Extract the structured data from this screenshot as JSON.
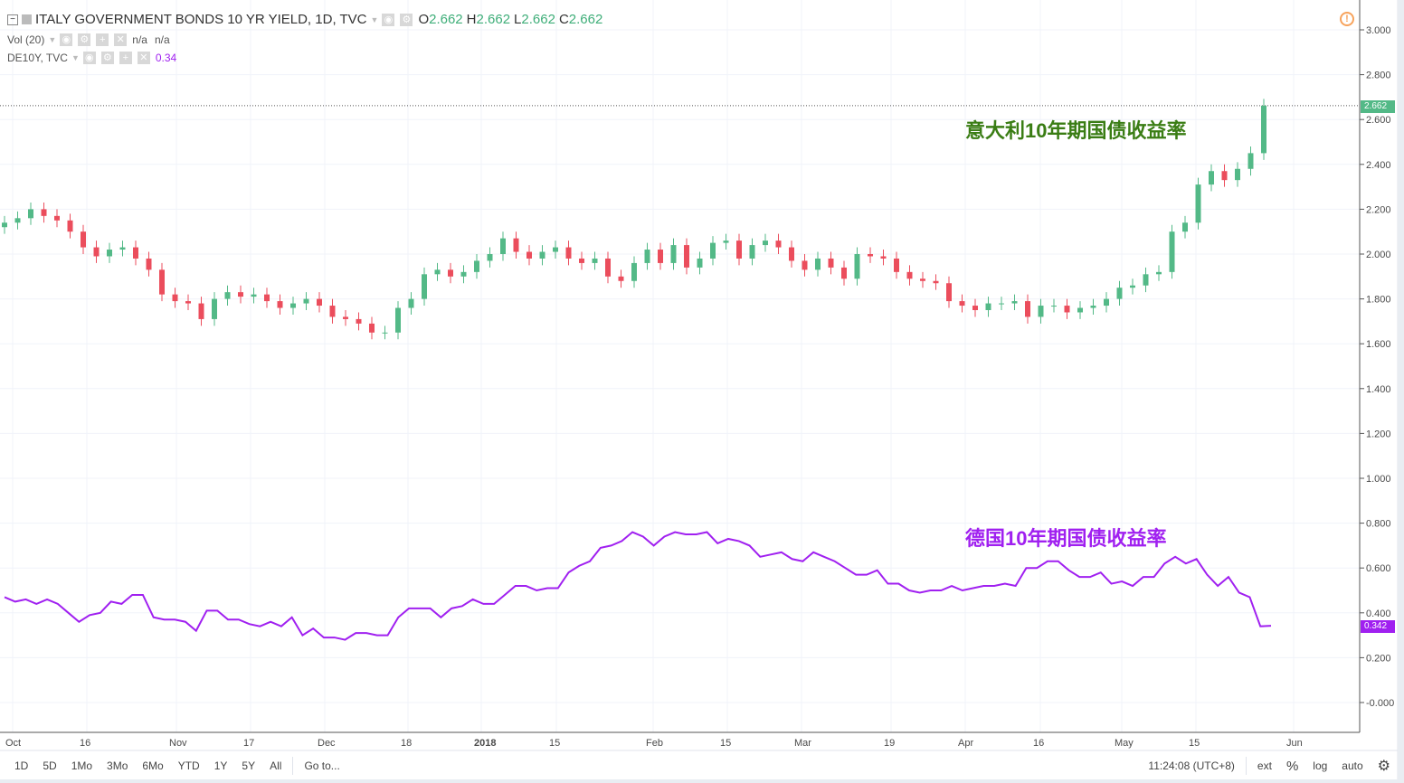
{
  "legend": {
    "symbol": "ITALY GOVERNMENT BONDS 10 YR YIELD, 1D, TVC",
    "o_label": "O",
    "o": "2.662",
    "h_label": "H",
    "h": "2.662",
    "l_label": "L",
    "l": "2.662",
    "c_label": "C",
    "c": "2.662",
    "vol": "Vol (20)",
    "vol_v1": "n/a",
    "vol_v2": "n/a",
    "de": "DE10Y, TVC",
    "de_v": "0.34"
  },
  "annotations": {
    "italy": "意大利10年期国债收益率",
    "germany": "德国10年期国债收益率"
  },
  "price_tags": {
    "italy": "2.662",
    "germany": "0.342"
  },
  "colors": {
    "up": "#53b987",
    "down": "#eb4d5c",
    "germany": "#a020f0",
    "italy_text": "#3a7d14"
  },
  "chart_data": {
    "type": "candlestick+line",
    "y_ticks": [
      "3.000",
      "2.800",
      "2.600",
      "2.400",
      "2.200",
      "2.000",
      "1.800",
      "1.600",
      "1.400",
      "1.200",
      "1.000",
      "0.800",
      "0.600",
      "0.400",
      "0.200",
      "-0.000"
    ],
    "ylim": [
      0,
      3
    ],
    "x_ticks": [
      "Oct",
      "16",
      "Nov",
      "17",
      "Dec",
      "18",
      "2018",
      "15",
      "Feb",
      "15",
      "Mar",
      "19",
      "Apr",
      "16",
      "May",
      "15",
      "Jun"
    ],
    "italy_closes": [
      2.14,
      2.16,
      2.2,
      2.17,
      2.15,
      2.1,
      2.03,
      1.99,
      2.02,
      2.03,
      1.98,
      1.93,
      1.82,
      1.79,
      1.78,
      1.71,
      1.8,
      1.83,
      1.81,
      1.82,
      1.79,
      1.76,
      1.78,
      1.8,
      1.77,
      1.72,
      1.71,
      1.69,
      1.65,
      1.65,
      1.76,
      1.8,
      1.91,
      1.93,
      1.9,
      1.92,
      1.97,
      2.0,
      2.07,
      2.01,
      1.98,
      2.01,
      2.03,
      1.98,
      1.96,
      1.98,
      1.9,
      1.88,
      1.96,
      2.02,
      1.96,
      2.04,
      1.94,
      1.98,
      2.05,
      2.06,
      1.98,
      2.04,
      2.06,
      2.03,
      1.97,
      1.93,
      1.98,
      1.94,
      1.89,
      2.0,
      1.99,
      1.98,
      1.92,
      1.89,
      1.88,
      1.87,
      1.79,
      1.77,
      1.75,
      1.78,
      1.78,
      1.79,
      1.72,
      1.77,
      1.77,
      1.74,
      1.76,
      1.77,
      1.8,
      1.85,
      1.86,
      1.91,
      1.92,
      2.1,
      2.14,
      2.31,
      2.37,
      2.33,
      2.38,
      2.45,
      2.662
    ],
    "germany": [
      0.47,
      0.45,
      0.46,
      0.44,
      0.46,
      0.44,
      0.4,
      0.36,
      0.39,
      0.4,
      0.45,
      0.44,
      0.48,
      0.48,
      0.38,
      0.37,
      0.37,
      0.36,
      0.32,
      0.41,
      0.41,
      0.37,
      0.37,
      0.35,
      0.34,
      0.36,
      0.34,
      0.38,
      0.3,
      0.33,
      0.29,
      0.29,
      0.28,
      0.31,
      0.31,
      0.3,
      0.3,
      0.38,
      0.42,
      0.42,
      0.42,
      0.38,
      0.42,
      0.43,
      0.46,
      0.44,
      0.44,
      0.48,
      0.52,
      0.52,
      0.5,
      0.51,
      0.51,
      0.58,
      0.61,
      0.63,
      0.69,
      0.7,
      0.72,
      0.76,
      0.74,
      0.7,
      0.74,
      0.76,
      0.75,
      0.75,
      0.76,
      0.71,
      0.73,
      0.72,
      0.7,
      0.65,
      0.66,
      0.67,
      0.64,
      0.63,
      0.67,
      0.65,
      0.63,
      0.6,
      0.57,
      0.57,
      0.59,
      0.53,
      0.53,
      0.5,
      0.49,
      0.5,
      0.5,
      0.52,
      0.5,
      0.51,
      0.52,
      0.52,
      0.53,
      0.52,
      0.6,
      0.6,
      0.63,
      0.63,
      0.59,
      0.56,
      0.56,
      0.58,
      0.53,
      0.54,
      0.52,
      0.56,
      0.56,
      0.62,
      0.65,
      0.62,
      0.64,
      0.57,
      0.52,
      0.56,
      0.49,
      0.47,
      0.34,
      0.342
    ]
  },
  "toolbar": {
    "ranges": [
      "1D",
      "5D",
      "1Mo",
      "3Mo",
      "6Mo",
      "YTD",
      "1Y",
      "5Y",
      "All"
    ],
    "goto": "Go to...",
    "time": "11:24:08 (UTC+8)",
    "ext": "ext",
    "pct": "%",
    "log": "log",
    "auto": "auto"
  }
}
